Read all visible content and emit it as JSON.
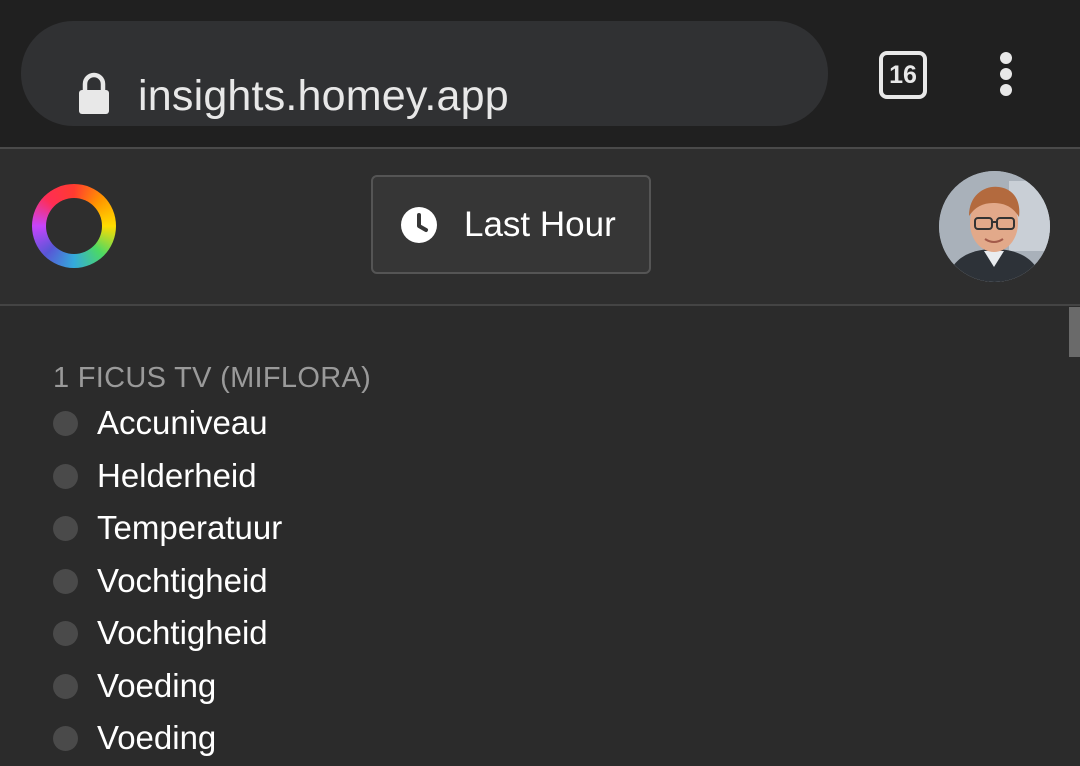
{
  "browser": {
    "url": "insights.homey.app",
    "tab_count": "16",
    "lock_icon": "lock-icon",
    "menu_icon": "more-vertical-icon"
  },
  "header": {
    "logo_icon": "homey-logo-icon",
    "time_range_icon": "clock-icon",
    "time_range_label": "Last Hour",
    "avatar_icon": "user-avatar"
  },
  "device": {
    "title": "1 FICUS TV (MIFLORA)",
    "capabilities": [
      {
        "label": "Accuniveau"
      },
      {
        "label": "Helderheid"
      },
      {
        "label": "Temperatuur"
      },
      {
        "label": "Vochtigheid"
      },
      {
        "label": "Vochtigheid"
      },
      {
        "label": "Voeding"
      },
      {
        "label": "Voeding"
      }
    ]
  },
  "colors": {
    "background": "#2b2b2b",
    "browser_bar": "#202020",
    "url_pill": "#303133",
    "muted_text": "#9a9a9a",
    "dot": "#4a4a4a"
  }
}
